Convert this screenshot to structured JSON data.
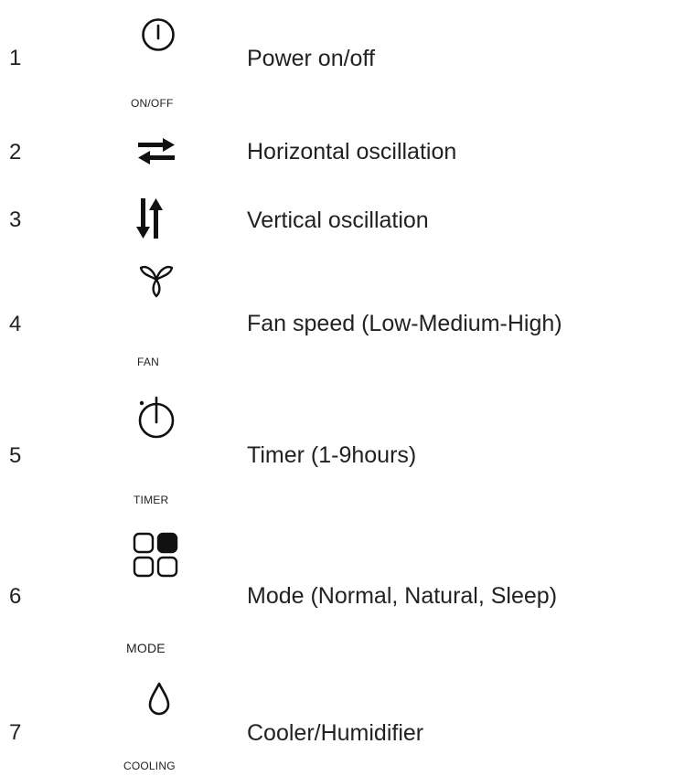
{
  "items": [
    {
      "number": "1",
      "icon": "power-icon",
      "caption": "ON/OFF",
      "description": "Power on/off"
    },
    {
      "number": "2",
      "icon": "horizontal-arrows-icon",
      "caption": "",
      "description": "Horizontal oscillation"
    },
    {
      "number": "3",
      "icon": "vertical-arrows-icon",
      "caption": "",
      "description": "Vertical oscillation"
    },
    {
      "number": "4",
      "icon": "fan-icon",
      "caption": "FAN",
      "description": "Fan speed (Low-Medium-High)"
    },
    {
      "number": "5",
      "icon": "timer-icon",
      "caption": "TIMER",
      "description": "Timer (1-9hours)"
    },
    {
      "number": "6",
      "icon": "mode-grid-icon",
      "caption": "MODE",
      "description": "Mode (Normal, Natural, Sleep)"
    },
    {
      "number": "7",
      "icon": "water-drop-icon",
      "caption": "COOLING",
      "description": "Cooler/Humidifier"
    }
  ]
}
